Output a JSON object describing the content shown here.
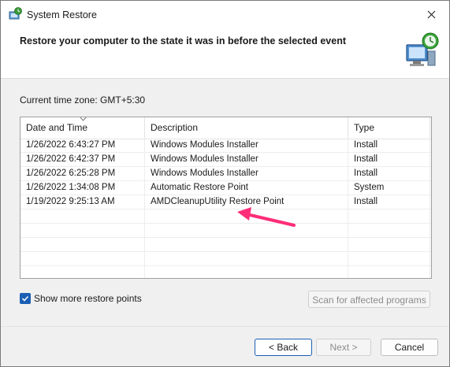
{
  "window": {
    "title": "System Restore"
  },
  "header": {
    "text": "Restore your computer to the state it was in before the selected event"
  },
  "timezone_label": "Current time zone: GMT+5:30",
  "table": {
    "columns": [
      "Date and Time",
      "Description",
      "Type"
    ],
    "rows": [
      [
        "1/26/2022 6:43:27 PM",
        "Windows Modules Installer",
        "Install"
      ],
      [
        "1/26/2022 6:42:37 PM",
        "Windows Modules Installer",
        "Install"
      ],
      [
        "1/26/2022 6:25:28 PM",
        "Windows Modules Installer",
        "Install"
      ],
      [
        "1/26/2022 1:34:08 PM",
        "Automatic Restore Point",
        "System"
      ],
      [
        "1/19/2022 9:25:13 AM",
        "AMDCleanupUtility Restore Point",
        "Install"
      ]
    ],
    "empty_rows": 5
  },
  "show_more": {
    "label": "Show more restore points",
    "checked": true
  },
  "scan_button": "Scan for affected programs",
  "buttons": {
    "back": "< Back",
    "next": "Next >",
    "cancel": "Cancel"
  },
  "colors": {
    "accent": "#1a5fb4",
    "annotation_arrow": "#ff2d78"
  },
  "icons": {
    "title": "system-restore-icon",
    "header": "computer-restore-icon",
    "close": "close-icon"
  }
}
